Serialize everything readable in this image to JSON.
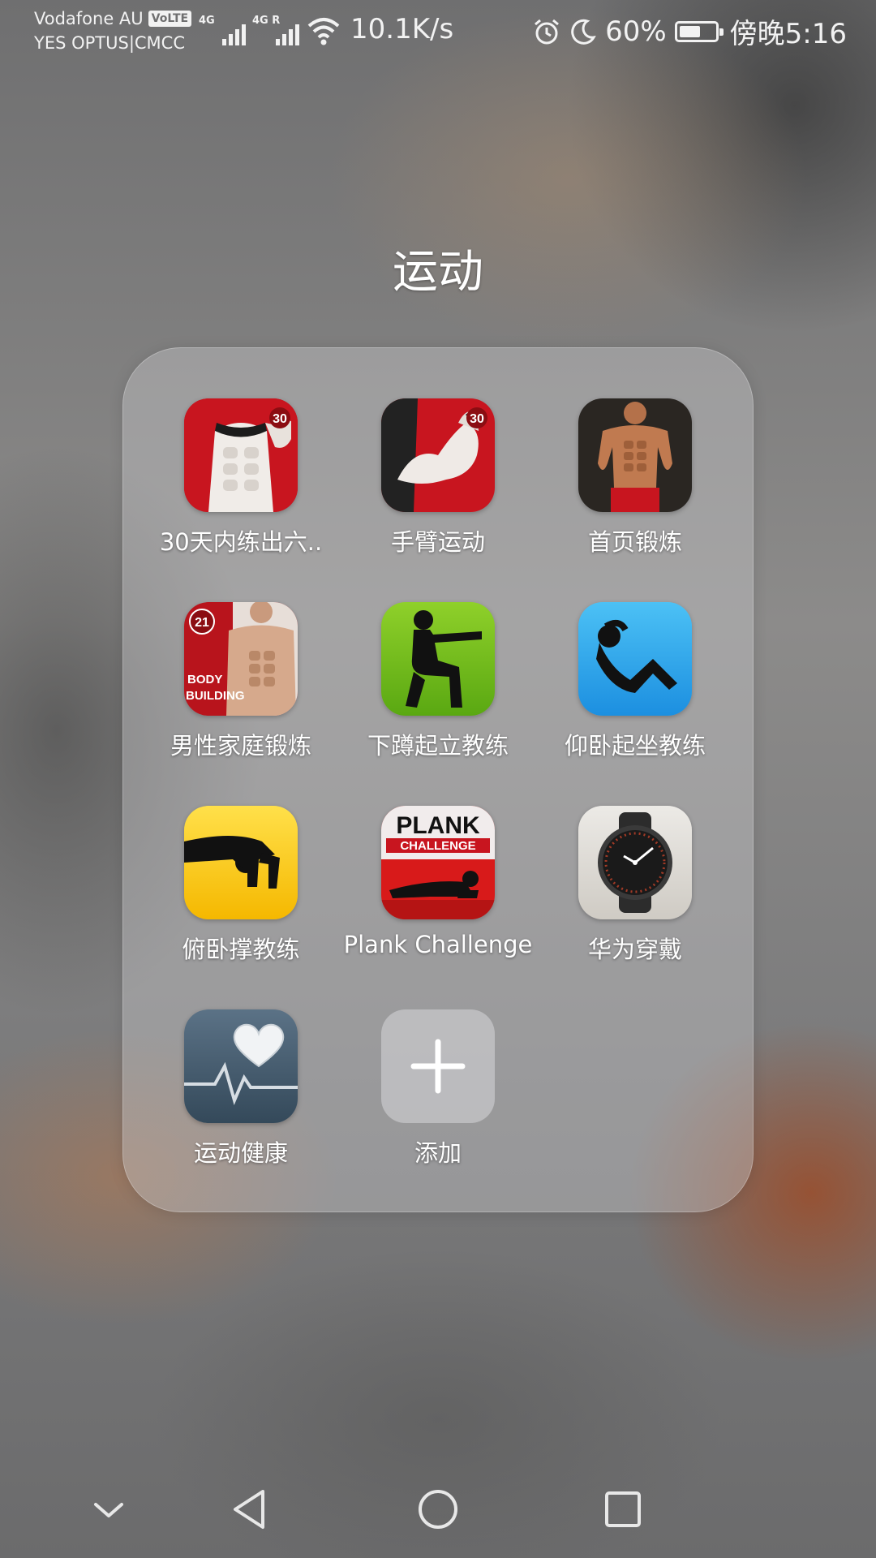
{
  "status_bar": {
    "carrier_1": "Vodafone AU",
    "volte": "VoLTE",
    "carrier_2": "YES OPTUS|CMCC",
    "signal_1_tag": "4G",
    "signal_2_tag": "4G R",
    "net_speed": "10.1K/s",
    "battery_pct": "60%",
    "battery_level": 0.6,
    "time": "傍晚5:16",
    "icons": [
      "alarm-icon",
      "moon-icon",
      "battery-icon",
      "wifi-icon",
      "signal-icon"
    ]
  },
  "folder": {
    "title": "运动",
    "apps": [
      {
        "label": "30天内练出六..",
        "icon": "six-pack-30-day-icon"
      },
      {
        "label": "手臂运动",
        "icon": "arm-workout-icon"
      },
      {
        "label": "首页锻炼",
        "icon": "home-workout-icon"
      },
      {
        "label": "男性家庭锻炼",
        "icon": "body-building-icon"
      },
      {
        "label": "下蹲起立教练",
        "icon": "squat-coach-icon"
      },
      {
        "label": "仰卧起坐教练",
        "icon": "situp-coach-icon"
      },
      {
        "label": "俯卧撑教练",
        "icon": "pushup-coach-icon"
      },
      {
        "label": "Plank Challenge",
        "icon": "plank-challenge-icon"
      },
      {
        "label": "华为穿戴",
        "icon": "huawei-wear-icon"
      },
      {
        "label": "运动健康",
        "icon": "health-heart-icon"
      },
      {
        "label": "添加",
        "icon": "plus-icon"
      }
    ],
    "badge_30": "30",
    "badge_21": "21",
    "body_building_text": "BODY BUILDING",
    "plank_text_1": "PLANK",
    "plank_text_2": "CHALLENGE"
  },
  "nav_bar": {
    "buttons": [
      "hide-keys-chevron-icon",
      "back-triangle-icon",
      "home-circle-icon",
      "recents-square-icon"
    ]
  }
}
